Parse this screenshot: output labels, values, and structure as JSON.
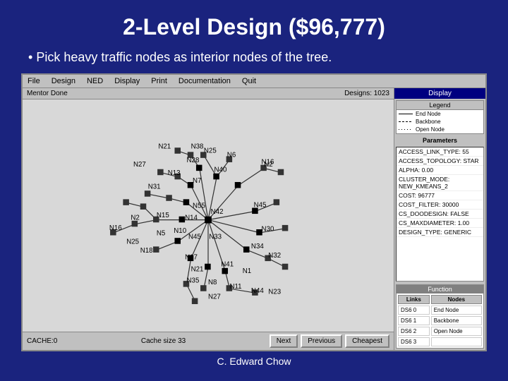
{
  "slide": {
    "title": "2-Level Design ($96,777)",
    "bullet": "Pick heavy traffic nodes  as interior nodes of the tree.",
    "author": "C. Edward Chow"
  },
  "app": {
    "title": "Mentor Done",
    "designs_label": "Designs: 1023",
    "cache_label": "CACHE:0",
    "cache_size": "Cache size 33",
    "display_label": "Display",
    "menu_items": [
      "File",
      "Design",
      "NED",
      "Display",
      "Print",
      "Documentation",
      "Quit"
    ],
    "buttons": {
      "next": "Next",
      "previous": "Previous",
      "cheapest": "Cheapest"
    },
    "parameters": {
      "title": "Parameters",
      "items": [
        "ACCESS_LINK_TYPE: 55",
        "ACCESS_TOPOLOGY: STAR",
        "ALPHA: 0.00",
        "CLUSTER_MODE: NEW_KMEANS_2",
        "COST: 96777",
        "COST_FILTER: 30000",
        "CS_DOODESIGN: FALSE",
        "CS_MAXDIAMETER: 1.00",
        "DESIGN_TYPE: GENERIC"
      ]
    },
    "legend": {
      "title": "Legend",
      "items": [
        "End Node",
        "Backbone",
        "Open Node"
      ]
    },
    "function": {
      "title": "Function",
      "cols": [
        "Links",
        "Nodes"
      ],
      "rows": [
        {
          "link": "DS6 0",
          "node": "End Node"
        },
        {
          "link": "DS6 1",
          "node": "Backbone"
        },
        {
          "link": "DS6 2",
          "node": "Open Node"
        },
        {
          "link": "DS6 3",
          "node": ""
        }
      ]
    }
  }
}
